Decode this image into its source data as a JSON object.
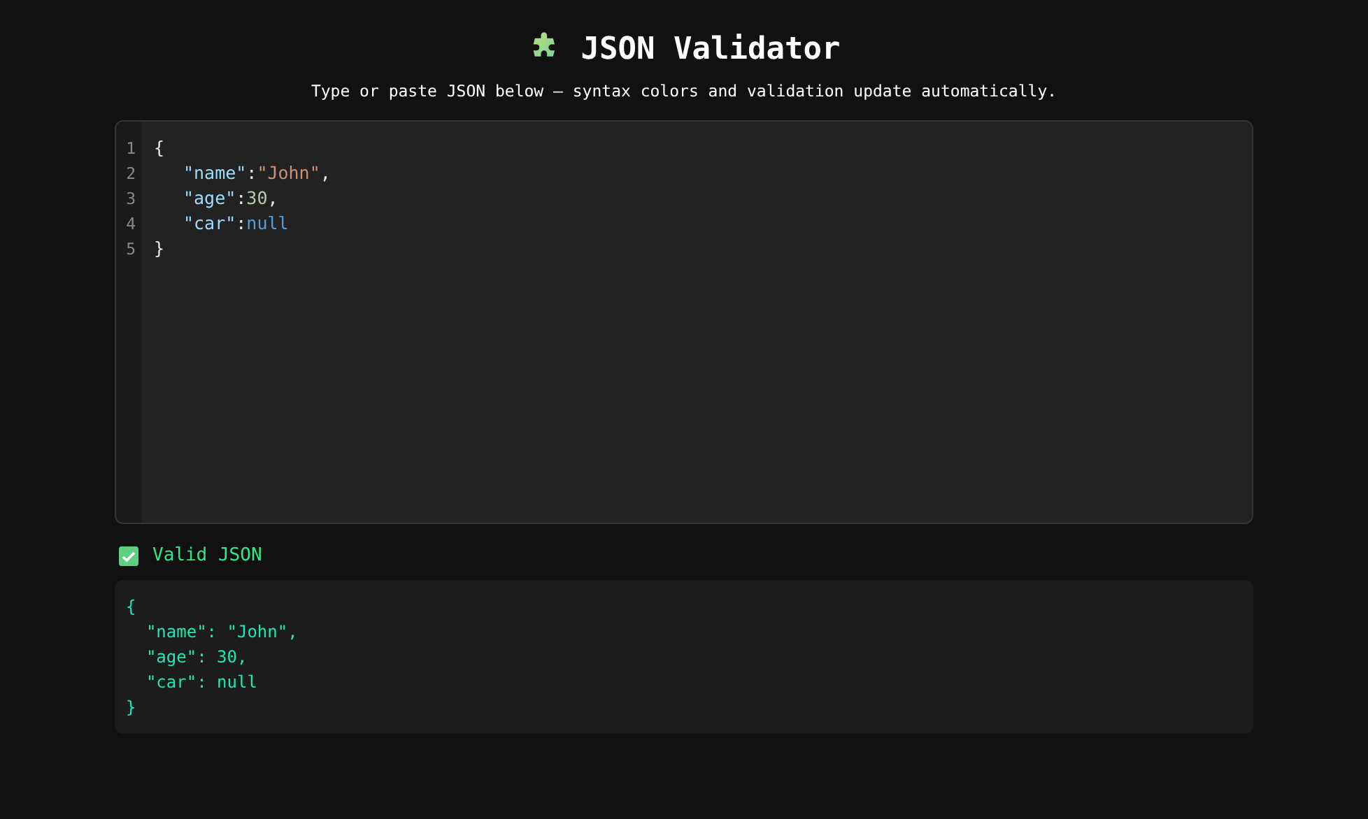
{
  "header": {
    "title": "JSON Validator",
    "subtitle": "Type or paste JSON below — syntax colors and validation update automatically."
  },
  "editor": {
    "lines": [
      {
        "number": "1",
        "indented": false,
        "tokens": [
          {
            "kind": "punct",
            "text": "{"
          }
        ]
      },
      {
        "number": "2",
        "indented": true,
        "tokens": [
          {
            "kind": "key",
            "text": "\"name\""
          },
          {
            "kind": "punct",
            "text": ":"
          },
          {
            "kind": "string",
            "text": "\"John\""
          },
          {
            "kind": "punct",
            "text": ","
          }
        ]
      },
      {
        "number": "3",
        "indented": true,
        "tokens": [
          {
            "kind": "key",
            "text": "\"age\""
          },
          {
            "kind": "punct",
            "text": ":"
          },
          {
            "kind": "number",
            "text": "30"
          },
          {
            "kind": "punct",
            "text": ","
          }
        ]
      },
      {
        "number": "4",
        "indented": true,
        "tokens": [
          {
            "kind": "key",
            "text": "\"car\""
          },
          {
            "kind": "punct",
            "text": ":"
          },
          {
            "kind": "null",
            "text": "null"
          }
        ]
      },
      {
        "number": "5",
        "indented": false,
        "tokens": [
          {
            "kind": "punct",
            "text": "}"
          }
        ]
      }
    ]
  },
  "status": {
    "valid": true,
    "text": "Valid JSON"
  },
  "output": "{\n  \"name\": \"John\",\n  \"age\": 30,\n  \"car\": null\n}"
}
